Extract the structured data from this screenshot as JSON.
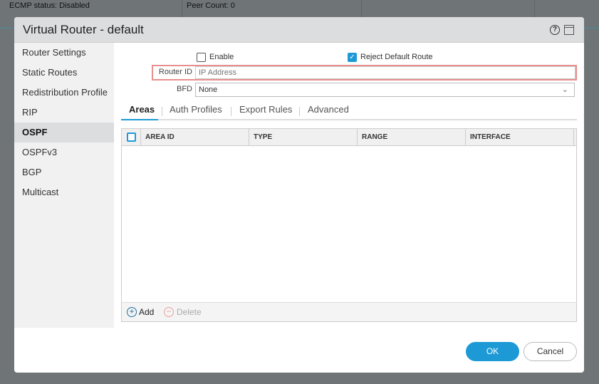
{
  "background": {
    "ecmp_status": "ECMP status: Disabled",
    "peer_count": "Peer Count: 0"
  },
  "dialog": {
    "title": "Virtual Router - default",
    "help_icon": "?"
  },
  "sidebar": {
    "items": [
      {
        "label": "Router Settings"
      },
      {
        "label": "Static Routes"
      },
      {
        "label": "Redistribution Profile"
      },
      {
        "label": "RIP"
      },
      {
        "label": "OSPF",
        "active": true
      },
      {
        "label": "OSPFv3"
      },
      {
        "label": "BGP"
      },
      {
        "label": "Multicast"
      }
    ]
  },
  "form": {
    "enable_label": "Enable",
    "enable_checked": false,
    "reject_label": "Reject Default Route",
    "reject_checked": true,
    "router_id_label": "Router ID",
    "router_id_placeholder": "IP Address",
    "router_id_value": "",
    "bfd_label": "BFD",
    "bfd_value": "None"
  },
  "tabs": [
    {
      "label": "Areas",
      "active": true
    },
    {
      "label": "Auth Profiles"
    },
    {
      "label": "Export Rules"
    },
    {
      "label": "Advanced"
    }
  ],
  "grid": {
    "columns": [
      "AREA ID",
      "TYPE",
      "RANGE",
      "INTERFACE"
    ],
    "rows": [],
    "add_label": "Add",
    "delete_label": "Delete"
  },
  "footer": {
    "ok_label": "OK",
    "cancel_label": "Cancel"
  },
  "colors": {
    "accent": "#1d9ad6",
    "error_border": "#e89090"
  }
}
